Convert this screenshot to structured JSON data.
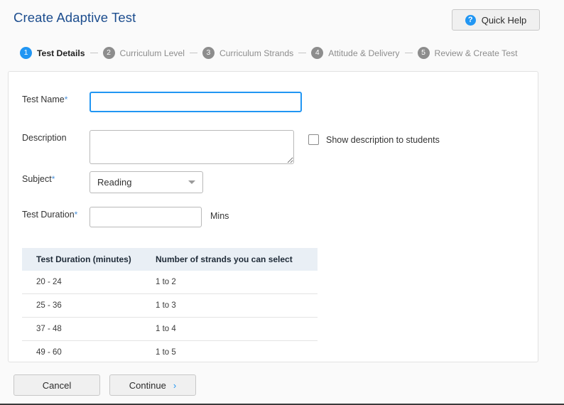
{
  "header": {
    "title": "Create Adaptive Test",
    "quick_help_label": "Quick Help",
    "quick_help_icon": "question-mark-circle-icon",
    "quick_help_glyph": "?",
    "accent_color": "#2196f3",
    "title_color": "#1c4d8e"
  },
  "stepper": {
    "steps": [
      {
        "number": "1",
        "label": "Test Details",
        "active": true
      },
      {
        "number": "2",
        "label": "Curriculum Level",
        "active": false
      },
      {
        "number": "3",
        "label": "Curriculum Strands",
        "active": false
      },
      {
        "number": "4",
        "label": "Attitude & Delivery",
        "active": false
      },
      {
        "number": "5",
        "label": "Review & Create Test",
        "active": false
      }
    ],
    "active_color": "#2196f3",
    "inactive_color": "#8d8d8d"
  },
  "form": {
    "test_name": {
      "label": "Test Name",
      "required_marker": "*",
      "value": "",
      "placeholder": "",
      "focused": true
    },
    "description": {
      "label": "Description",
      "value": "",
      "placeholder": "",
      "resize_handle_icon": "resize-grip-icon"
    },
    "show_description": {
      "label": "Show description to students",
      "checked": false
    },
    "subject": {
      "label": "Subject",
      "required_marker": "*",
      "selected": "Reading",
      "caret_icon": "chevron-down-icon"
    },
    "test_duration": {
      "label": "Test Duration",
      "required_marker": "*",
      "value": "",
      "placeholder": "",
      "unit": "Mins"
    }
  },
  "table": {
    "headers": [
      "Test Duration (minutes)",
      "Number of strands you can select"
    ],
    "rows": [
      [
        "20 - 24",
        "1 to 2"
      ],
      [
        "25 - 36",
        "1 to 3"
      ],
      [
        "37 - 48",
        "1 to 4"
      ],
      [
        "49 - 60",
        "1 to 5"
      ]
    ],
    "header_bg": "#e9eff5"
  },
  "footer": {
    "cancel_label": "Cancel",
    "continue_label": "Continue",
    "continue_icon": "chevron-right-icon",
    "continue_glyph": "›"
  }
}
